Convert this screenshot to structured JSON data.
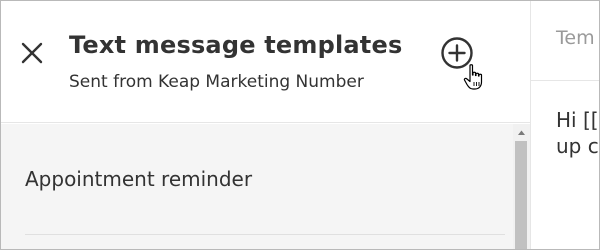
{
  "panel": {
    "title": "Text message templates",
    "subtitle": "Sent from Keap Marketing Number"
  },
  "buttons": {
    "close_icon": "close-icon",
    "add_icon": "plus-circle-icon"
  },
  "templates": [
    {
      "label": "Appointment reminder"
    }
  ],
  "right_panel": {
    "tab_label": "Tem",
    "body_line1": "Hi [[",
    "body_line2": "up c"
  },
  "colors": {
    "text": "#333333",
    "muted": "#9a9a9a",
    "list_bg": "#f5f5f5",
    "scroll_thumb": "#c1c1c1"
  }
}
